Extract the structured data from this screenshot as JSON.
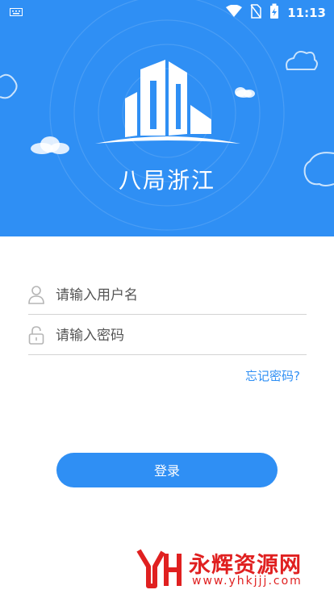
{
  "status_bar": {
    "time": "11:13",
    "icons": [
      "keyboard-icon",
      "wifi-icon",
      "no-sim-icon",
      "battery-charging-icon"
    ]
  },
  "hero": {
    "brand_name": "八局浙江",
    "logo_icon": "building-logo-icon",
    "background_color": "#2f8ff4"
  },
  "form": {
    "username": {
      "placeholder": "请输入用户名",
      "value": "",
      "icon": "user-icon"
    },
    "password": {
      "placeholder": "请输入密码",
      "value": "",
      "icon": "lock-icon"
    },
    "forgot_label": "忘记密码?",
    "login_label": "登录"
  },
  "watermark": {
    "name": "永辉资源网",
    "url": "www.yhkjjj.com",
    "color": "#e02020"
  }
}
